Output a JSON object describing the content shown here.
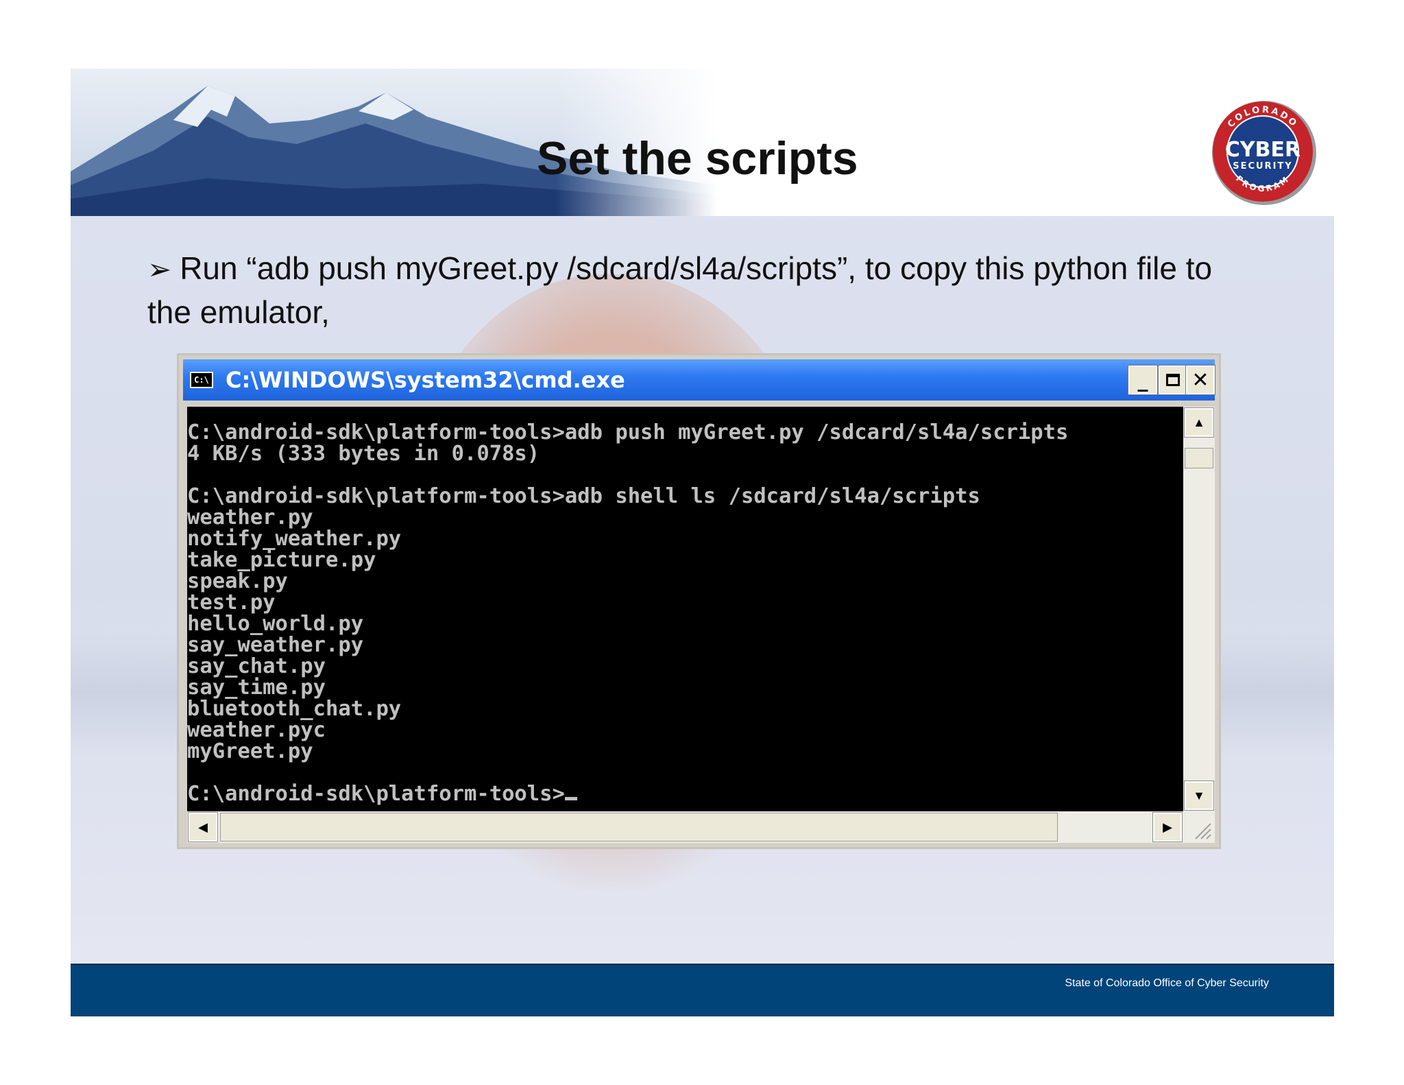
{
  "slide": {
    "title": "Set the scripts",
    "bullet_text": "Run “adb push myGreet.py /sdcard/sl4a/scripts”, to copy this python file to the emulator,",
    "footer_text": "State of Colorado Office of Cyber Security"
  },
  "logo": {
    "top_text": "COLORADO",
    "main_text": "CYBER",
    "sub_text": "SECURITY",
    "bottom_text": "PROGRAM"
  },
  "cmd": {
    "icon_text": "C:\\",
    "title": "C:\\WINDOWS\\system32\\cmd.exe",
    "lines": [
      "C:\\android-sdk\\platform-tools>adb push myGreet.py /sdcard/sl4a/scripts",
      "4 KB/s (333 bytes in 0.078s)",
      "",
      "C:\\android-sdk\\platform-tools>adb shell ls /sdcard/sl4a/scripts",
      "weather.py",
      "notify_weather.py",
      "take_picture.py",
      "speak.py",
      "test.py",
      "hello_world.py",
      "say_weather.py",
      "say_chat.py",
      "say_time.py",
      "bluetooth_chat.py",
      "weather.pyc",
      "myGreet.py",
      "",
      "C:\\android-sdk\\platform-tools>"
    ]
  },
  "colors": {
    "titlebar": "#1e63dd",
    "footer": "#004479",
    "logo_red": "#c4242a"
  }
}
